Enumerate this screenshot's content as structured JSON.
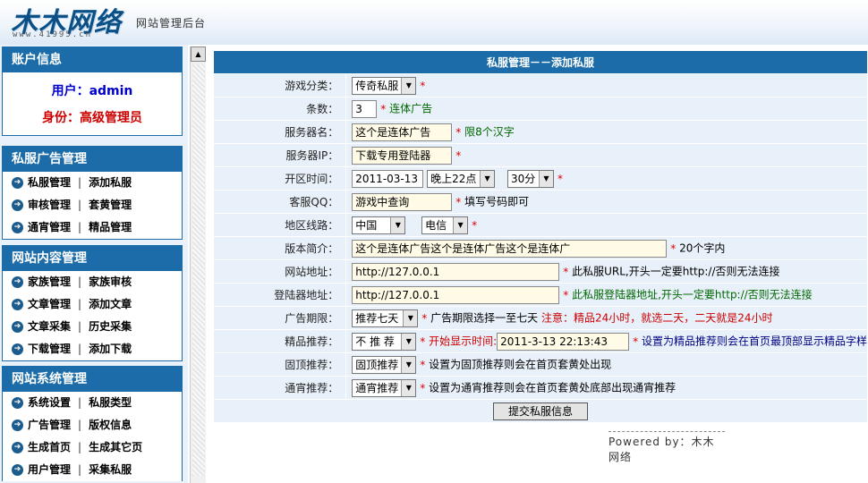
{
  "header": {
    "logo": "木木网络",
    "logo_url": "www.41995.cn",
    "admin_title": "网站管理后台"
  },
  "account": {
    "title": "账户信息",
    "user_label": "用户：admin",
    "role_label": "身份：高级管理员"
  },
  "menus": [
    {
      "title": "私服广告管理",
      "rows": [
        [
          "私服管理",
          "添加私服"
        ],
        [
          "审核管理",
          "套黄管理"
        ],
        [
          "通宵管理",
          "精品管理"
        ]
      ]
    },
    {
      "title": "网站内容管理",
      "rows": [
        [
          "家族管理",
          "家族审核"
        ],
        [
          "文章管理",
          "添加文章"
        ],
        [
          "文章采集",
          "历史采集"
        ],
        [
          "下载管理",
          "添加下载"
        ]
      ]
    },
    {
      "title": "网站系统管理",
      "rows": [
        [
          "系统设置",
          "私服类型"
        ],
        [
          "广告管理",
          "版权信息"
        ],
        [
          "生成首页",
          "生成其它页"
        ],
        [
          "用户管理",
          "采集私服"
        ]
      ]
    }
  ],
  "form": {
    "title": "私服管理－－添加私服",
    "category": {
      "label": "游戏分类：",
      "value": "传奇私服"
    },
    "count": {
      "label": "条数：",
      "value": "3",
      "hint": "连体广告"
    },
    "server_name": {
      "label": "服务器名：",
      "value": "这个是连体广告",
      "hint": "限8个汉字"
    },
    "server_ip": {
      "label": "服务器IP：",
      "value": "下载专用登陆器"
    },
    "open_time": {
      "label": "开区时间：",
      "date": "2011-03-13",
      "hour": "晚上22点",
      "minute": "30分"
    },
    "qq": {
      "label": "客服QQ：",
      "value": "游戏中查询",
      "hint": "填写号码即可"
    },
    "line": {
      "label": "地区线路：",
      "region": "中国",
      "isp": "电信"
    },
    "intro": {
      "label": "版本简介：",
      "value": "这个是连体广告这个是连体广告这个是连体广",
      "hint": "20个字内"
    },
    "site_url": {
      "label": "网站地址：",
      "value": "http://127.0.0.1",
      "hint": "此私服URL,开头一定要http://否则无法连接"
    },
    "login_url": {
      "label": "登陆器地址：",
      "value": "http://127.0.0.1",
      "hint": "此私服登陆器地址,开头一定要http://否则无法连接"
    },
    "ad_period": {
      "label": "广告期限：",
      "value": "推荐七天",
      "hint": "广告期限选择一至七天",
      "warn": "注意：精品24小时，就选二天，二天就是24小时"
    },
    "featured": {
      "label": "精品推荐：",
      "value": "不 推 荐",
      "start_label": "开始显示时间:",
      "start_value": "2011-3-13 22:13:43",
      "hint": "设置为精品推荐则会在首页最顶部显示精品字样"
    },
    "pinned": {
      "label": "固顶推荐：",
      "value": "固顶推荐",
      "hint": "设置为固顶推荐则会在首页套黄处出现"
    },
    "overnight": {
      "label": "通宵推荐：",
      "value": "通宵推荐",
      "hint": "设置为通宵推荐则会在首页套黄处底部出现通宵推荐"
    },
    "submit": "提交私服信息"
  },
  "footer": {
    "powered": "Powered by：木木网络"
  }
}
